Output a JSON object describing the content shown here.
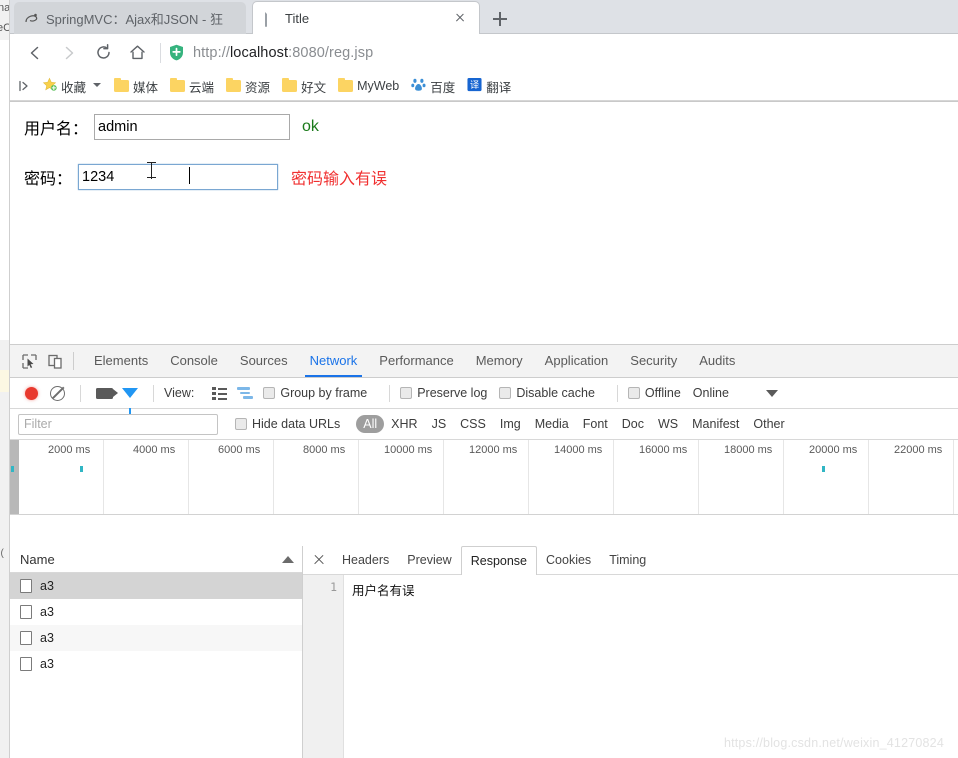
{
  "background_window": {
    "fragments": [
      "na",
      "eC",
      "t ("
    ]
  },
  "browser": {
    "tabs": [
      {
        "title": "SpringMVC：Ajax和JSON - 狂",
        "favicon": "spring-icon",
        "active": false
      },
      {
        "title": "Title",
        "favicon": "document-icon",
        "active": true
      }
    ],
    "new_tab_label": "+",
    "nav": {
      "back_icon": "back-arrow-icon",
      "forward_icon": "forward-arrow-icon",
      "reload_icon": "reload-icon",
      "home_icon": "home-icon"
    },
    "omnibox": {
      "security_icon": "shield-plus-icon",
      "url_prefix": "http://",
      "url_host": "localhost",
      "url_suffix": ":8080/reg.jsp",
      "full_url": "http://localhost:8080/reg.jsp"
    },
    "bookmarks": [
      {
        "label": "收藏",
        "icon": "star-icon",
        "has_chevron": true
      },
      {
        "label": "媒体",
        "icon": "folder-icon"
      },
      {
        "label": "云端",
        "icon": "folder-icon"
      },
      {
        "label": "资源",
        "icon": "folder-icon"
      },
      {
        "label": "好文",
        "icon": "folder-icon"
      },
      {
        "label": "MyWeb",
        "icon": "folder-icon"
      },
      {
        "label": "百度",
        "icon": "baidu-icon"
      },
      {
        "label": "翻译",
        "icon": "translate-icon"
      }
    ]
  },
  "page": {
    "username": {
      "label": "用户名：",
      "value": "admin",
      "placeholder": "",
      "message": "ok",
      "message_color": "#1a7a1a"
    },
    "password": {
      "label": "密码：",
      "value": "1234",
      "placeholder": "",
      "message": "密码输入有误",
      "message_color": "#f03030"
    }
  },
  "devtools": {
    "icons": {
      "inspect": "inspect-element-icon",
      "device": "device-toolbar-icon"
    },
    "tabs": [
      {
        "label": "Elements",
        "active": false
      },
      {
        "label": "Console",
        "active": false
      },
      {
        "label": "Sources",
        "active": false
      },
      {
        "label": "Network",
        "active": true
      },
      {
        "label": "Performance",
        "active": false
      },
      {
        "label": "Memory",
        "active": false
      },
      {
        "label": "Application",
        "active": false
      },
      {
        "label": "Security",
        "active": false
      },
      {
        "label": "Audits",
        "active": false
      }
    ],
    "network_toolbar": {
      "record_icon": "record-button-icon",
      "clear_icon": "clear-icon",
      "capture_screenshots_icon": "camera-icon",
      "filter_icon": "funnel-icon",
      "view_label": "View:",
      "list_view_icon": "list-view-icon",
      "waterfall_view_icon": "waterfall-view-icon",
      "group_by_frame": "Group by frame",
      "preserve_log": "Preserve log",
      "disable_cache": "Disable cache",
      "offline": "Offline",
      "throttling": "Online",
      "throttling_caret_icon": "chevron-down-icon"
    },
    "filter_bar": {
      "filter_placeholder": "Filter",
      "hide_data_urls": "Hide data URLs",
      "types": [
        "All",
        "XHR",
        "JS",
        "CSS",
        "Img",
        "Media",
        "Font",
        "Doc",
        "WS",
        "Manifest",
        "Other"
      ],
      "active_type": "All"
    },
    "timeline": {
      "ticks": [
        "2000 ms",
        "4000 ms",
        "6000 ms",
        "8000 ms",
        "10000 ms",
        "12000 ms",
        "14000 ms",
        "16000 ms",
        "18000 ms",
        "20000 ms",
        "22000 ms"
      ],
      "marker_color": "#31b6c4",
      "markers_x": [
        11,
        80,
        822
      ]
    },
    "requests": {
      "column_header": "Name",
      "sort_icon": "sort-ascending-icon",
      "rows": [
        {
          "name": "a3",
          "icon": "document-icon",
          "selected": true
        },
        {
          "name": "a3",
          "icon": "document-icon",
          "selected": false
        },
        {
          "name": "a3",
          "icon": "document-icon",
          "selected": false
        },
        {
          "name": "a3",
          "icon": "document-icon",
          "selected": false
        }
      ]
    },
    "detail": {
      "close_icon": "close-icon",
      "tabs": [
        {
          "label": "Headers",
          "active": false
        },
        {
          "label": "Preview",
          "active": false
        },
        {
          "label": "Response",
          "active": true
        },
        {
          "label": "Cookies",
          "active": false
        },
        {
          "label": "Timing",
          "active": false
        }
      ],
      "response_lines": [
        {
          "number": "1",
          "text": "用户名有误"
        }
      ]
    }
  },
  "watermark": "https://blog.csdn.net/weixin_41270824"
}
